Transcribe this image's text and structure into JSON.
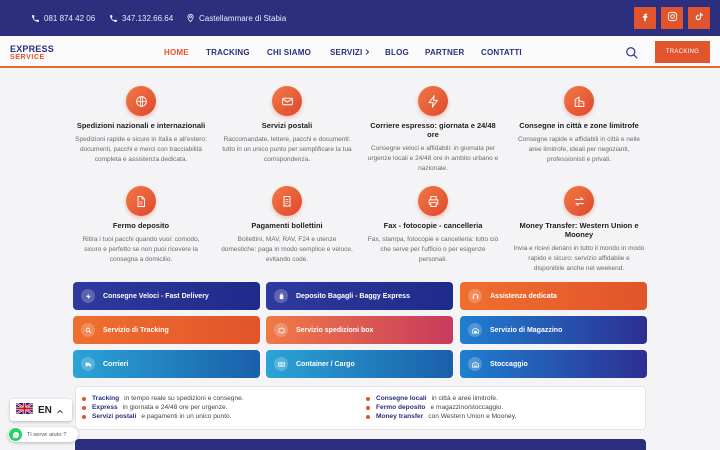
{
  "topbar": {
    "phone1": "081 874 42 06",
    "phone2": "347.132.66.64",
    "location": "Castellammare di Stabia",
    "socials": [
      "facebook-icon",
      "instagram-icon",
      "tiktok-icon"
    ]
  },
  "header": {
    "logo_line1": "EXPRESS",
    "logo_line2": "SERVICE",
    "nav": [
      "HOME",
      "TRACKING",
      "CHI SIAMO",
      "SERVIZI",
      "BLOG",
      "PARTNER",
      "CONTATTI"
    ],
    "tracking_button": "TRACKING"
  },
  "services": [
    {
      "icon": "globe-icon",
      "title": "Spedizioni nazionali e internazionali",
      "desc": "Spedizioni rapide e sicure in Italia e all'estero: documenti, pacchi e merci con tracciabilità completa e assistenza dedicata."
    },
    {
      "icon": "mail-icon",
      "title": "Servizi postali",
      "desc": "Raccomandate, lettere, pacchi e documenti: tutto in un unico punto per semplificare la tua corrispondenza."
    },
    {
      "icon": "bolt-icon",
      "title": "Corriere espresso: giornata e 24/48 ore",
      "desc": "Consegne veloci e affidabili: in giornata per urgenze locali e 24/48 ore in ambito urbano e nazionale."
    },
    {
      "icon": "building-icon",
      "title": "Consegne in città e zone limitrofe",
      "desc": "Consegne rapide e affidabili in città e nelle aree limitrofe, ideali per negozianti, professionisti e privati."
    },
    {
      "icon": "file-icon",
      "title": "Fermo deposito",
      "desc": "Ritira i tuoi pacchi quando vuoi: comodo, sicuro e perfetto se non puoi ricevere la consegna a domicilio."
    },
    {
      "icon": "receipt-icon",
      "title": "Pagamenti bollettini",
      "desc": "Bollettini, MAV, RAV, F24 e utenze domestiche: paga in modo semplice e veloce, evitando code."
    },
    {
      "icon": "printer-icon",
      "title": "Fax - fotocopie - cancelleria",
      "desc": "Fax, stampa, fotocopie e cancelleria: tutto ciò che serve per l'ufficio o per esigenze personali."
    },
    {
      "icon": "transfer-icon",
      "title": "Money Transfer: Western Union e Mooney",
      "desc": "Invia e ricevi denaro in tutto il mondo in modo rapido e sicuro: servizio affidabile e disponibile anche nel weekend."
    }
  ],
  "buttons": [
    {
      "label": "Consegne Veloci - Fast Delivery",
      "style": "g-blue",
      "icon": "bolt-icon"
    },
    {
      "label": "Deposito Bagagli - Baggy Express",
      "style": "g-blue",
      "icon": "luggage-icon"
    },
    {
      "label": "Assistenza dedicata",
      "style": "g-orange",
      "icon": "headset-icon"
    },
    {
      "label": "Servizio di Tracking",
      "style": "g-orange",
      "icon": "search-icon"
    },
    {
      "label": "Servizio spedizioni box",
      "style": "g-red",
      "icon": "box-icon"
    },
    {
      "label": "Servizio di Magazzino",
      "style": "g-bluemid",
      "icon": "warehouse-icon"
    },
    {
      "label": "Corrieri",
      "style": "g-teal",
      "icon": "truck-icon"
    },
    {
      "label": "Container / Cargo",
      "style": "g-teal",
      "icon": "container-icon"
    },
    {
      "label": "Stoccaggio",
      "style": "g-bluemid",
      "icon": "stock-icon"
    }
  ],
  "info": {
    "left": [
      {
        "bold": "Tracking",
        "text": "in tempo reale su spedizioni e consegne."
      },
      {
        "bold": "Express",
        "text": "in giornata e 24/48 ore per urgenze."
      },
      {
        "bold": "Servizi postali",
        "text": "e pagamenti in un unico punto."
      }
    ],
    "right": [
      {
        "bold": "Consegne locali",
        "text": "in città e aree limitrofe."
      },
      {
        "bold": "Fermo deposito",
        "text": "e magazzino/stoccaggio."
      },
      {
        "bold": "Money transfer",
        "text": "con Western Union e Mooney."
      }
    ]
  },
  "language": {
    "code": "EN"
  },
  "help": {
    "label": "Ti serve aiuto ?"
  },
  "colors": {
    "primary": "#2b2f7e",
    "accent": "#e2542b"
  }
}
